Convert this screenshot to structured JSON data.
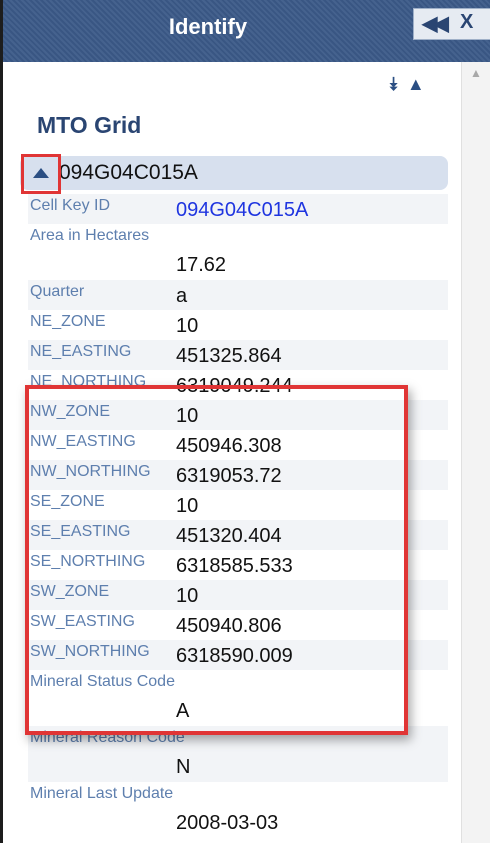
{
  "window": {
    "title": "Identify",
    "collapse_icon": "double-chevron-left-icon",
    "close_label": "X"
  },
  "toolbar": {
    "expand_all_icon": "double-chevron-down-icon",
    "collapse_all_icon": "chevron-up-icon",
    "expand_all_glyph": "⯯",
    "collapse_all_glyph": "▲"
  },
  "layer": {
    "title": "MTO Grid"
  },
  "feature": {
    "id": "094G04C015A",
    "toggle_icon": "triangle-up-icon"
  },
  "attributes": [
    {
      "label": "Cell Key ID",
      "value": "094G04C015A",
      "link": true,
      "two_line": false
    },
    {
      "label": "Area in Hectares",
      "value": "17.62",
      "link": false,
      "two_line": true
    },
    {
      "label": "Quarter",
      "value": "a",
      "link": false,
      "two_line": false
    },
    {
      "label": "NE_ZONE",
      "value": "10",
      "link": false,
      "two_line": false
    },
    {
      "label": "NE_EASTING",
      "value": "451325.864",
      "link": false,
      "two_line": false
    },
    {
      "label": "NE_NORTHING",
      "value": "6319049.244",
      "link": false,
      "two_line": false
    },
    {
      "label": "NW_ZONE",
      "value": "10",
      "link": false,
      "two_line": false
    },
    {
      "label": "NW_EASTING",
      "value": "450946.308",
      "link": false,
      "two_line": false
    },
    {
      "label": "NW_NORTHING",
      "value": "6319053.72",
      "link": false,
      "two_line": false
    },
    {
      "label": "SE_ZONE",
      "value": "10",
      "link": false,
      "two_line": false
    },
    {
      "label": "SE_EASTING",
      "value": "451320.404",
      "link": false,
      "two_line": false
    },
    {
      "label": "SE_NORTHING",
      "value": "6318585.533",
      "link": false,
      "two_line": false
    },
    {
      "label": "SW_ZONE",
      "value": "10",
      "link": false,
      "two_line": false
    },
    {
      "label": "SW_EASTING",
      "value": "450940.806",
      "link": false,
      "two_line": false
    },
    {
      "label": "SW_NORTHING",
      "value": "6318590.009",
      "link": false,
      "two_line": false
    },
    {
      "label": "Mineral Status Code",
      "value": "A",
      "link": false,
      "two_line": true
    },
    {
      "label": "Mineral Reason Code",
      "value": "N",
      "link": false,
      "two_line": true
    },
    {
      "label": "Mineral Last Update",
      "value": "2008-03-03",
      "link": false,
      "two_line": true
    }
  ],
  "colors": {
    "titlebar": "#3b5a88",
    "highlight": "#e03535",
    "label": "#5e7fae",
    "link": "#1f35e0"
  }
}
